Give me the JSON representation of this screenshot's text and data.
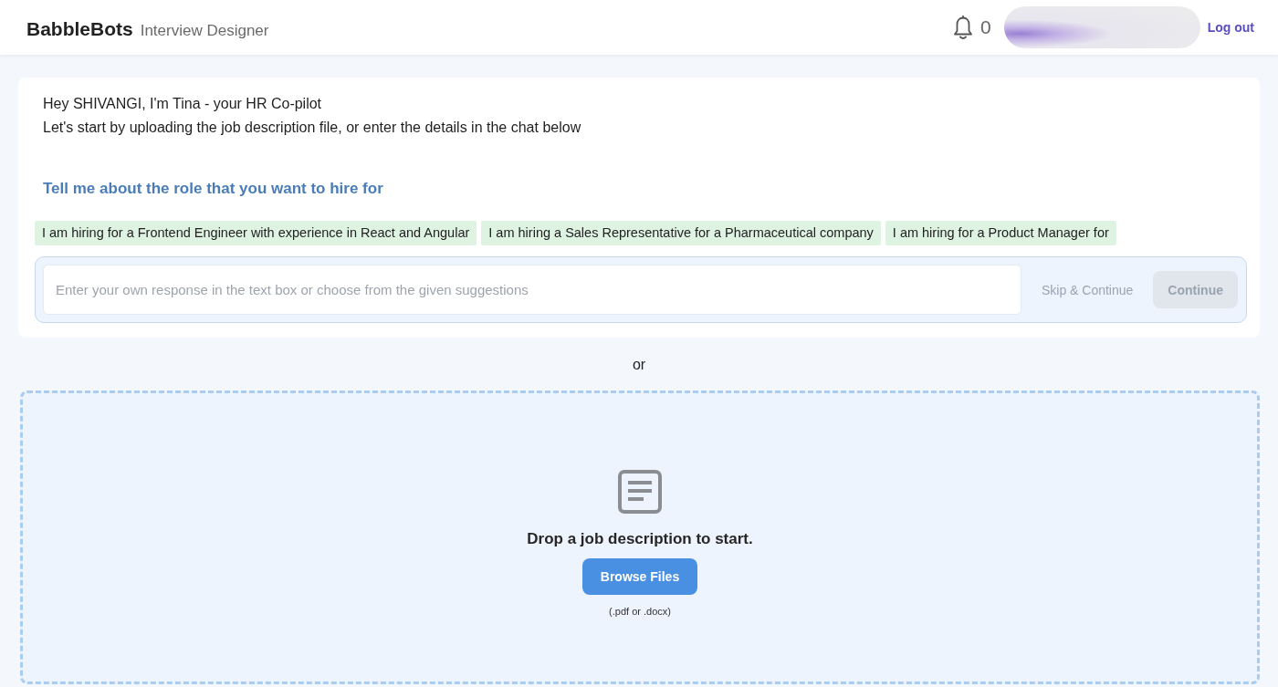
{
  "header": {
    "brand": "BabbleBots",
    "subtitle": "Interview Designer",
    "notification_count": "0",
    "logout": "Log out"
  },
  "chat": {
    "greeting": "Hey SHIVANGI, I'm Tina - your HR Co-pilot",
    "intro": "Let's start by uploading the job description file, or enter the details in the chat below",
    "prompt": "Tell me about the role that you want to hire for",
    "suggestions": [
      "I am hiring for a Frontend Engineer with experience in React and Angular",
      "I am hiring a Sales Representative for a Pharmaceutical company",
      "I am hiring for a Product Manager for"
    ],
    "input": {
      "placeholder": "Enter your own response in the text box or choose from the given suggestions"
    },
    "buttons": [
      {
        "label": "Skip & Continue",
        "kind": "text",
        "disabled": true
      },
      {
        "label": "Continue",
        "kind": "filled",
        "disabled": true
      }
    ]
  },
  "separator": "or",
  "dropzone": {
    "message": "Drop a job description to start.",
    "button": "Browse Files",
    "hint": "(.pdf or .docx)"
  }
}
